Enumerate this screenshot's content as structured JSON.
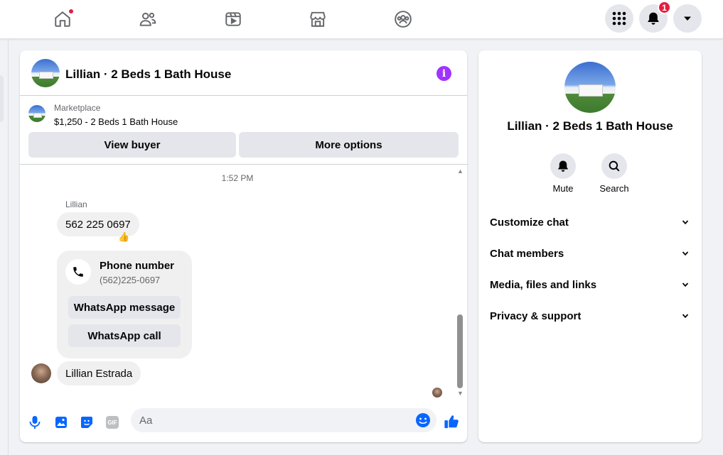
{
  "nav": {
    "items": [
      {
        "name": "home-icon",
        "has_dot": true
      },
      {
        "name": "friends-icon"
      },
      {
        "name": "video-icon"
      },
      {
        "name": "marketplace-icon"
      },
      {
        "name": "groups-icon"
      }
    ],
    "menu_icon": "grid-menu-icon",
    "notifications_badge": "1",
    "account_icon": "caret-down-icon"
  },
  "chat": {
    "title": "Lillian · 2 Beds 1 Bath House",
    "info_glyph": "i",
    "marketplace": {
      "label": "Marketplace",
      "item": "$1,250 - 2 Beds 1 Bath House",
      "view_buyer": "View buyer",
      "more_options": "More options"
    },
    "messages": {
      "timestamp": "1:52 PM",
      "sender": "Lillian",
      "phone_message": "562 225 0697",
      "reaction": "👍",
      "card": {
        "title": "Phone number",
        "subtitle": "(562)225-0697",
        "whatsapp_message": "WhatsApp message",
        "whatsapp_call": "WhatsApp call"
      },
      "last_message": "Lillian Estrada"
    },
    "composer": {
      "placeholder": "Aa",
      "gif_label": "GIF",
      "icons": [
        "microphone-icon",
        "photo-icon",
        "sticker-icon",
        "gif-icon",
        "emoji-icon",
        "like-icon"
      ]
    },
    "accent": "#0866ff"
  },
  "info_panel": {
    "name": "Lillian · 2 Beds 1 Bath House",
    "actions": {
      "mute": "Mute",
      "search": "Search"
    },
    "sections": [
      "Customize chat",
      "Chat members",
      "Media, files and links",
      "Privacy & support"
    ]
  }
}
